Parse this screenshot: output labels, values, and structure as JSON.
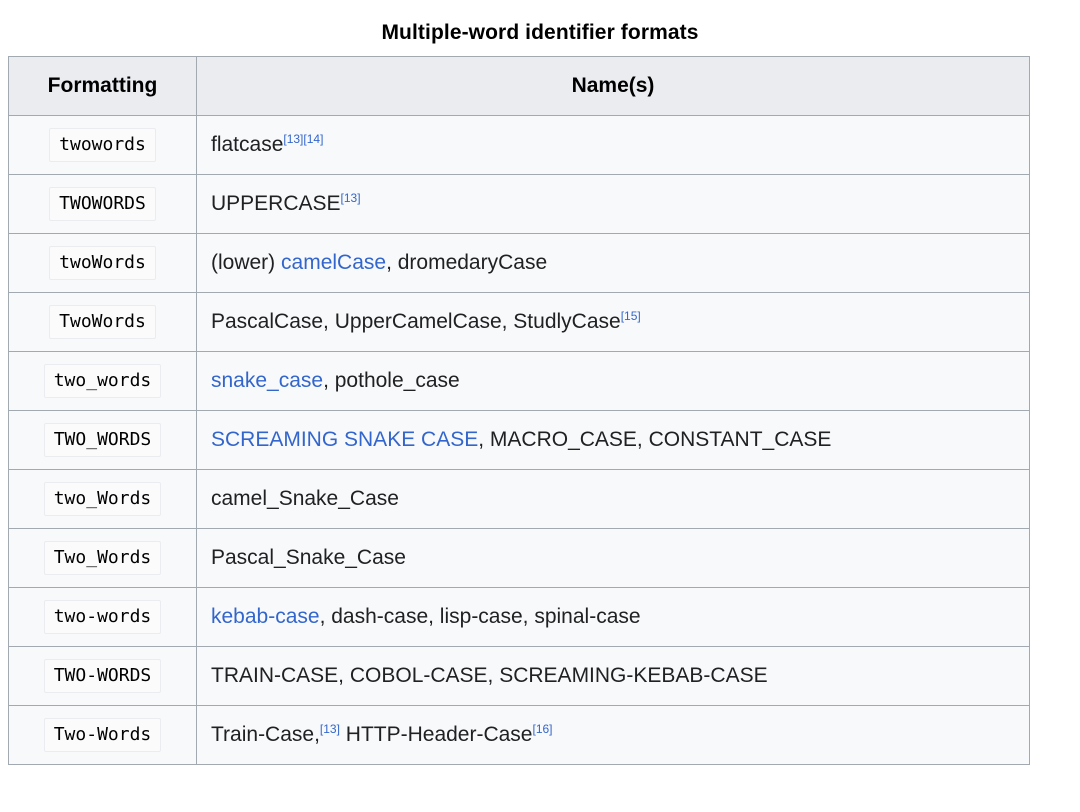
{
  "table": {
    "caption": "Multiple-word identifier formats",
    "columns": [
      "Formatting",
      "Name(s)"
    ],
    "link_color": "#3366cc",
    "header_bg": "#eaecf0",
    "cell_bg": "#f8f9fa",
    "border_color": "#a2a9b1",
    "rows": [
      {
        "formatting": "twowords",
        "names": [
          {
            "text": "flatcase",
            "link": false
          }
        ],
        "refs": [
          "[13]",
          "[14]"
        ],
        "refs_position": "end"
      },
      {
        "formatting": "TWOWORDS",
        "names": [
          {
            "text": "UPPERCASE",
            "link": false
          }
        ],
        "refs": [
          "[13]"
        ],
        "refs_position": "end"
      },
      {
        "formatting": "twoWords",
        "names": [
          {
            "text": "(lower) ",
            "link": false
          },
          {
            "text": "camelCase",
            "link": true
          },
          {
            "text": ", dromedaryCase",
            "link": false
          }
        ],
        "refs": [],
        "refs_position": "end"
      },
      {
        "formatting": "TwoWords",
        "names": [
          {
            "text": "PascalCase, UpperCamelCase, StudlyCase",
            "link": false
          }
        ],
        "refs": [
          "[15]"
        ],
        "refs_position": "end"
      },
      {
        "formatting": "two_words",
        "names": [
          {
            "text": "snake_case",
            "link": true
          },
          {
            "text": ", pothole_case",
            "link": false
          }
        ],
        "refs": [],
        "refs_position": "end"
      },
      {
        "formatting": "TWO_WORDS",
        "names": [
          {
            "text": "SCREAMING SNAKE CASE",
            "link": true
          },
          {
            "text": ", MACRO_CASE, CONSTANT_CASE",
            "link": false
          }
        ],
        "refs": [],
        "refs_position": "end"
      },
      {
        "formatting": "two_Words",
        "names": [
          {
            "text": "camel_Snake_Case",
            "link": false
          }
        ],
        "refs": [],
        "refs_position": "end"
      },
      {
        "formatting": "Two_Words",
        "names": [
          {
            "text": "Pascal_Snake_Case",
            "link": false
          }
        ],
        "refs": [],
        "refs_position": "end"
      },
      {
        "formatting": "two-words",
        "names": [
          {
            "text": "kebab-case",
            "link": true
          },
          {
            "text": ", dash-case, lisp-case, spinal-case",
            "link": false
          }
        ],
        "refs": [],
        "refs_position": "end"
      },
      {
        "formatting": "TWO-WORDS",
        "names": [
          {
            "text": "TRAIN-CASE, COBOL-CASE, SCREAMING-KEBAB-CASE",
            "link": false
          }
        ],
        "refs": [],
        "refs_position": "end"
      },
      {
        "formatting": "Two-Words",
        "names": [
          {
            "text": "Train-Case,",
            "link": false,
            "trailing_refs": [
              "[13]"
            ]
          },
          {
            "text": " HTTP-Header-Case",
            "link": false
          }
        ],
        "refs": [
          "[16]"
        ],
        "refs_position": "end"
      }
    ]
  }
}
